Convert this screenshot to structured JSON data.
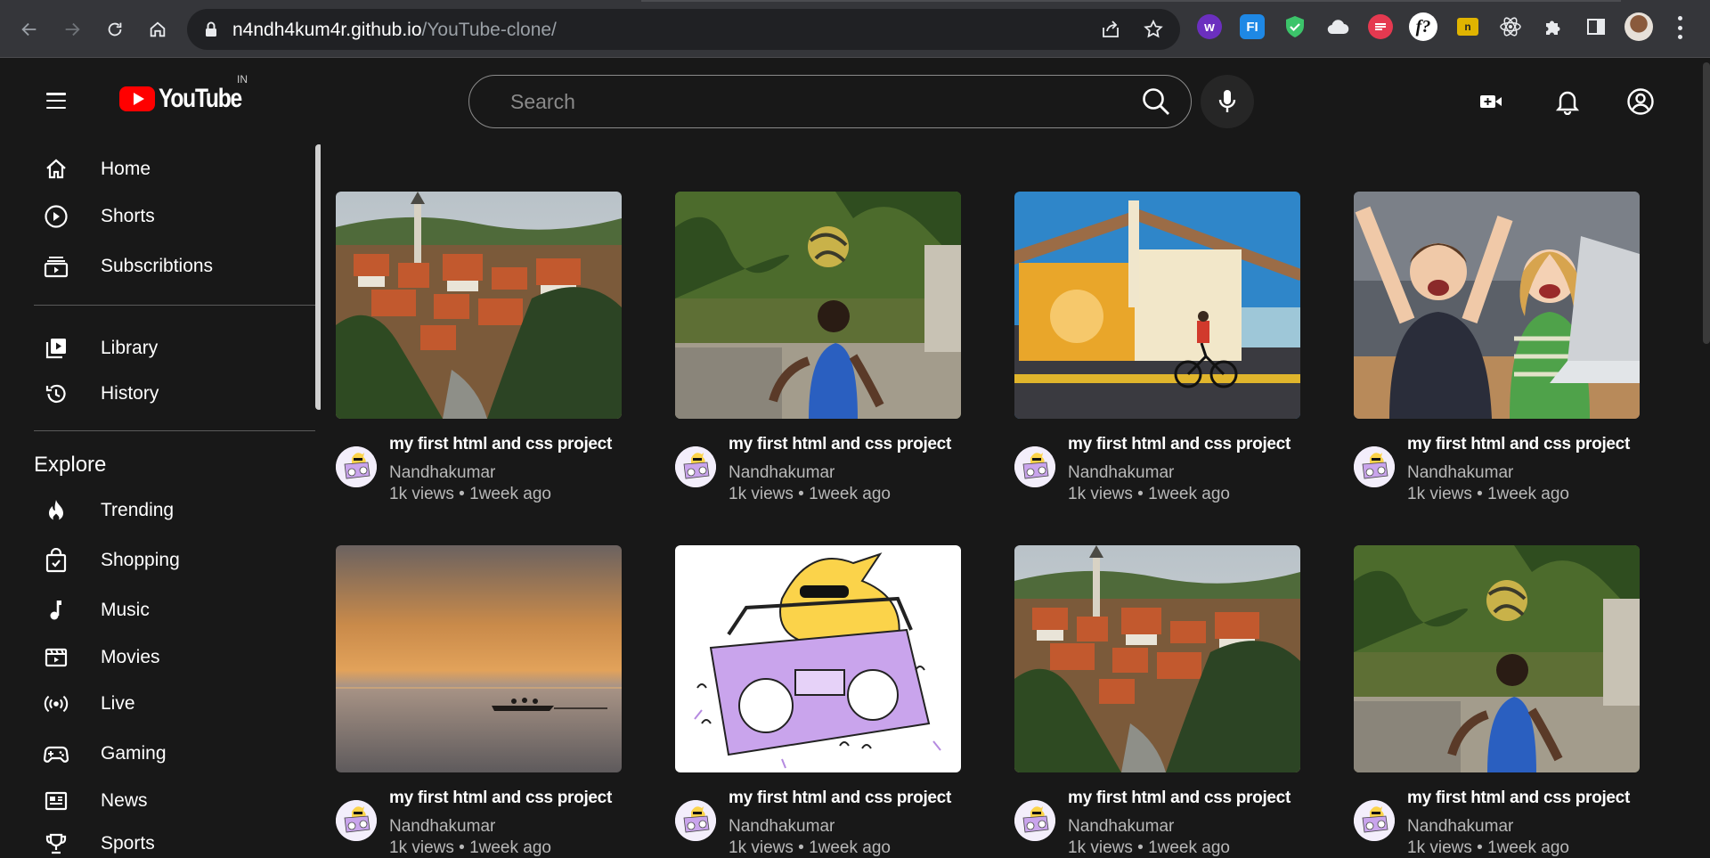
{
  "browser": {
    "url_host": "n4ndh4kum4r.github.io",
    "url_path": "/YouTube-clone/"
  },
  "header": {
    "logo_text": "YouTube",
    "country_code": "IN",
    "search_placeholder": "Search"
  },
  "sidebar": {
    "items": [
      {
        "label": "Home",
        "icon": "home-icon"
      },
      {
        "label": "Shorts",
        "icon": "shorts-icon"
      },
      {
        "label": "Subscribtions",
        "icon": "subscriptions-icon"
      },
      {
        "label": "Library",
        "icon": "library-icon"
      },
      {
        "label": "History",
        "icon": "history-icon"
      }
    ],
    "explore_heading": "Explore",
    "explore_items": [
      {
        "label": "Trending",
        "icon": "trending-icon"
      },
      {
        "label": "Shopping",
        "icon": "shopping-icon"
      },
      {
        "label": "Music",
        "icon": "music-icon"
      },
      {
        "label": "Movies",
        "icon": "movies-icon"
      },
      {
        "label": "Live",
        "icon": "live-icon"
      },
      {
        "label": "Gaming",
        "icon": "gaming-icon"
      },
      {
        "label": "News",
        "icon": "news-icon"
      },
      {
        "label": "Sports",
        "icon": "sports-icon"
      }
    ]
  },
  "videos": [
    {
      "title": "my first html and css project",
      "channel": "Nandhakumar",
      "meta": "1k views • 1week ago",
      "thumb": "town"
    },
    {
      "title": "my first html and css project",
      "channel": "Nandhakumar",
      "meta": "1k views • 1week ago",
      "thumb": "football"
    },
    {
      "title": "my first html and css project",
      "channel": "Nandhakumar",
      "meta": "1k views • 1week ago",
      "thumb": "house"
    },
    {
      "title": "my first html and css project",
      "channel": "Nandhakumar",
      "meta": "1k views • 1week ago",
      "thumb": "kids"
    },
    {
      "title": "my first html and css project",
      "channel": "Nandhakumar",
      "meta": "1k views • 1week ago",
      "thumb": "sunset"
    },
    {
      "title": "my first html and css project",
      "channel": "Nandhakumar",
      "meta": "1k views • 1week ago",
      "thumb": "boombox"
    },
    {
      "title": "my first html and css project",
      "channel": "Nandhakumar",
      "meta": "1k views • 1week ago",
      "thumb": "town"
    },
    {
      "title": "my first html and css project",
      "channel": "Nandhakumar",
      "meta": "1k views • 1week ago",
      "thumb": "football"
    }
  ],
  "colors": {
    "background": "#181818",
    "brand_red": "#ff0000",
    "secondary_text": "#b8b8b8"
  }
}
